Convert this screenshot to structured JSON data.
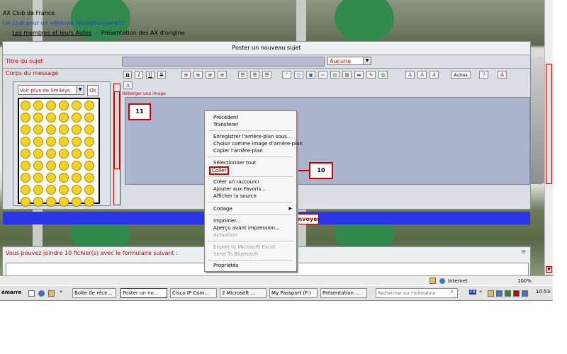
{
  "site": {
    "title": "AX Club de France",
    "subtitle": "Un club pour un véhicule révolutionnaire!!!",
    "breadcrumb": {
      "bullet": "::",
      "link": "Les membres et leurs Autos",
      "separator": "::",
      "current": "Présentation des AX d'origine"
    }
  },
  "form": {
    "panel_title": "Poster un nouveau sujet",
    "subject_label": "Titre du sujet",
    "subject_value": "",
    "subject_type": "Aucune",
    "body_label": "Corps du message",
    "smileys_select": "Voir plus de Smileys",
    "smileys_ok": "Ok",
    "toolbar": [
      "B",
      "I",
      "U",
      "S",
      "Autres"
    ],
    "host_image_link": "Héberger une image",
    "send_button": "Envoyer",
    "attach_text": "Vous pouvez joindre 10 fichier(s) avec le formulaire suivant :"
  },
  "callouts": {
    "editor": "11",
    "menu": "10"
  },
  "context_menu": {
    "items": [
      {
        "label": "Précédent",
        "enabled": true
      },
      {
        "label": "Transférer",
        "enabled": true
      },
      {
        "label": "Enregistrer l'arrière-plan sous...",
        "enabled": true
      },
      {
        "label": "Choisir comme image d'arrière-plan",
        "enabled": true
      },
      {
        "label": "Copier l'arrière-plan",
        "enabled": true
      },
      {
        "label": "Sélectionner tout",
        "enabled": true
      },
      {
        "label": "Coller",
        "enabled": true
      },
      {
        "label": "Créer un raccourci",
        "enabled": true
      },
      {
        "label": "Ajouter aux Favoris...",
        "enabled": true
      },
      {
        "label": "Afficher la source",
        "enabled": true
      },
      {
        "label": "Codage",
        "enabled": true
      },
      {
        "label": "Imprimer...",
        "enabled": true
      },
      {
        "label": "Aperçu avant impression...",
        "enabled": true
      },
      {
        "label": "Actualiser",
        "enabled": false
      },
      {
        "label": "Export to Microsoft Excel",
        "enabled": false
      },
      {
        "label": "Send To Bluetooth",
        "enabled": false
      },
      {
        "label": "Propriétés",
        "enabled": true
      }
    ]
  },
  "status_bar": {
    "zone": "Internet",
    "zoom": "100%"
  },
  "taskbar": {
    "start": "émarrer",
    "buttons": [
      "Boîte de réce...",
      "Poster un no...",
      "Cisco IP Com...",
      "2 Microsoft ...",
      "My Passport (F:)",
      "Présentation ..."
    ],
    "search_placeholder": "Rechercher sur l'ordinateur",
    "language": "FR",
    "clock": "10:53"
  },
  "colors": {
    "red_label": "#cc0000",
    "blue_bar": "#2a35e8",
    "callout_red": "#d40000"
  }
}
